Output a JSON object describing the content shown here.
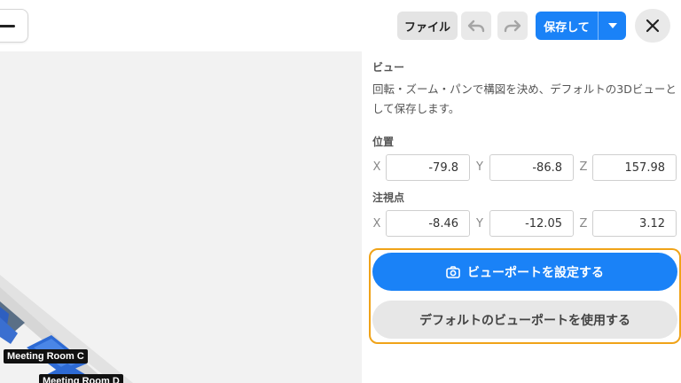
{
  "toolbar": {
    "file_label": "ファイル",
    "save_label": "保存して",
    "icons": [
      "menu-icon",
      "undo-icon",
      "redo-icon",
      "chevron-down-icon",
      "close-icon"
    ]
  },
  "viewport": {
    "room_labels": [
      "Meeting Room C",
      "Meeting Room D"
    ]
  },
  "panel": {
    "section_title": "ビュー",
    "description": "回転・ズーム・パンで構図を決め、デフォルトの3Dビューとして保存します。",
    "position": {
      "title": "位置",
      "x_label": "X",
      "y_label": "Y",
      "z_label": "Z",
      "x": "-79.8",
      "y": "-86.8",
      "z": "157.98"
    },
    "target": {
      "title": "注視点",
      "x_label": "X",
      "y_label": "Y",
      "z_label": "Z",
      "x": "-8.46",
      "y": "-12.05",
      "z": "3.12"
    },
    "set_viewport_label": "ビューポートを設定する",
    "use_default_label": "デフォルトのビューポートを使用する"
  },
  "colors": {
    "accent": "#1a82f7",
    "focus_ring": "#f0a318",
    "viewport_bg": "#f2f2f2"
  }
}
